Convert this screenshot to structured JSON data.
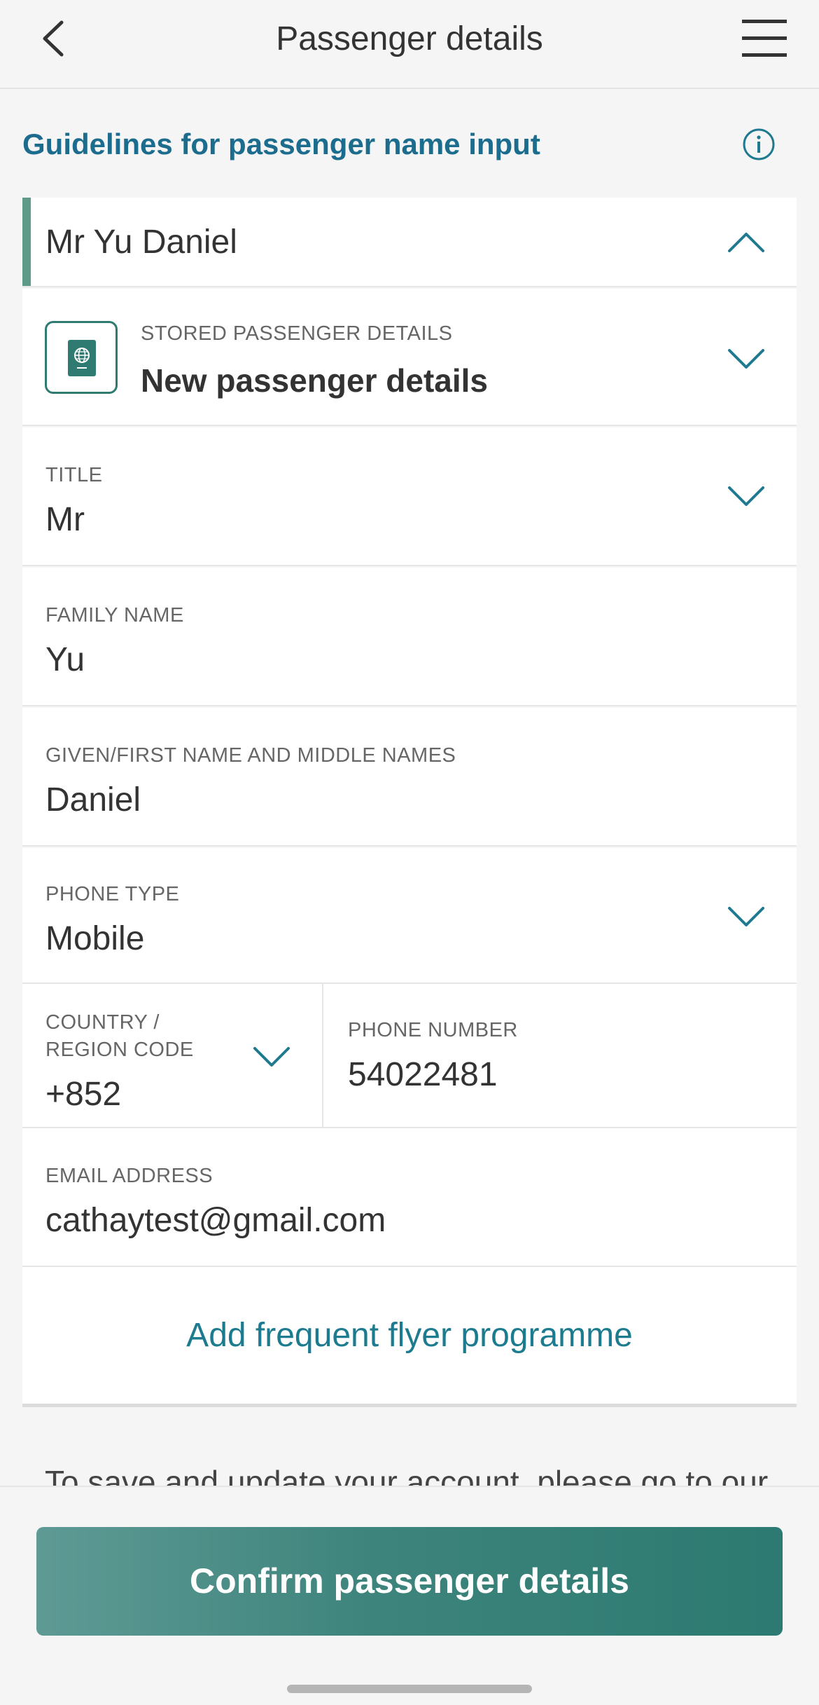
{
  "header": {
    "title": "Passenger details",
    "back_icon": "chevron-left-icon",
    "menu_icon": "hamburger-menu-icon"
  },
  "guidelines": {
    "label": "Guidelines for passenger name input",
    "icon": "info-icon"
  },
  "passenger": {
    "name": "Mr Yu Daniel",
    "expanded": true
  },
  "stored_details": {
    "label": "STORED PASSENGER DETAILS",
    "value": "New passenger details",
    "icon": "passport-icon"
  },
  "fields": {
    "title": {
      "label": "TITLE",
      "value": "Mr"
    },
    "family_name": {
      "label": "FAMILY NAME",
      "value": "Yu"
    },
    "given_name": {
      "label": "GIVEN/FIRST NAME AND MIDDLE NAMES",
      "value": "Daniel"
    },
    "phone_type": {
      "label": "PHONE TYPE",
      "value": "Mobile"
    },
    "country_code": {
      "label_line1": "COUNTRY /",
      "label_line2": "REGION CODE",
      "value": "+852"
    },
    "phone_number": {
      "label": "PHONE NUMBER",
      "value": "54022481"
    },
    "email": {
      "label": "EMAIL ADDRESS",
      "value": "cathaytest@gmail.com"
    }
  },
  "ffp_link": "Add frequent flyer programme",
  "note_text": "To save and update your account, please go to our",
  "confirm_button": "Confirm passenger details",
  "colors": {
    "accent_blue": "#1c6c8e",
    "link_teal": "#1c7b8f",
    "brand_green": "#2f7b72",
    "chevron": "#1f7a90"
  }
}
